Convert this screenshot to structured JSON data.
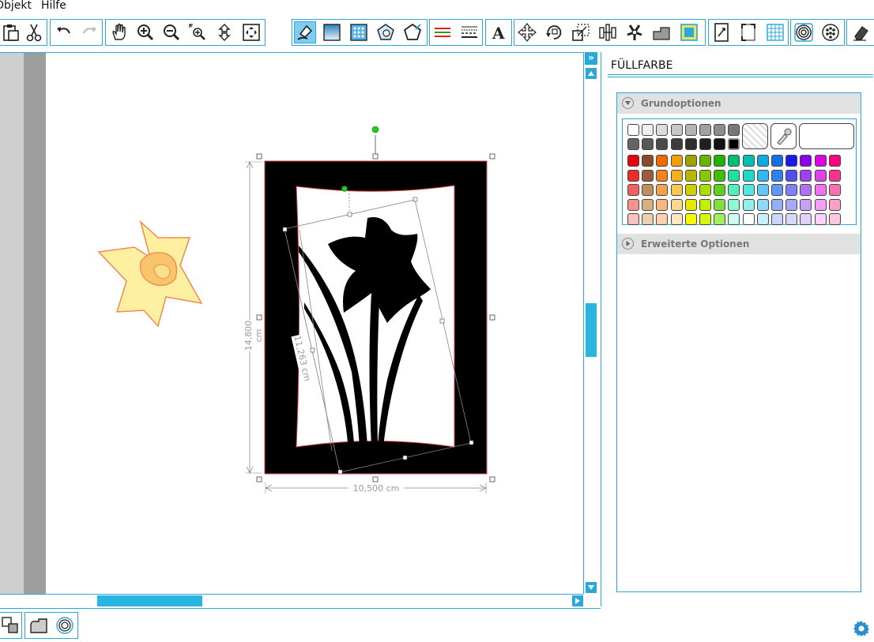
{
  "menu": {
    "objekt": "Objekt",
    "hilfe": "Hilfe"
  },
  "toolbar": {
    "groups": [
      {
        "buttons": [
          "paste-icon",
          "cut-icon"
        ]
      },
      {
        "buttons": [
          "undo-icon",
          "redo-icon"
        ]
      },
      {
        "buttons": [
          "pan-hand-icon",
          "zoom-in-icon",
          "zoom-out-icon",
          "zoom-select-icon",
          "zoom-fit-page-icon",
          "zoom-fit-all-icon"
        ]
      },
      {
        "buttons": [
          "fill-color-icon",
          "gradient-icon",
          "fill-pattern-icon",
          "advanced-fill-icon",
          "line-color-icon"
        ]
      },
      {
        "buttons": [
          "line-style-icon",
          "line-width-icon"
        ]
      },
      {
        "buttons": [
          "text-tool-icon"
        ]
      },
      {
        "buttons": [
          "move-tool-icon",
          "rotate-tool-icon",
          "scale-tool-icon",
          "align-tool-icon",
          "replicate-tool-icon",
          "modify-tool-icon",
          "mirror-tool-icon",
          "trace-icon"
        ]
      },
      {
        "buttons": [
          "page-setup-icon",
          "registration-marks-icon",
          "grid-icon"
        ]
      },
      {
        "buttons": [
          "offset-icon",
          "dots-icon"
        ]
      },
      {
        "buttons": [
          "eraser-icon"
        ]
      }
    ],
    "active": "fill-color-icon"
  },
  "canvas": {
    "dim_height": "14,800 cm",
    "dim_width": "10,500 cm",
    "dim_diagonal": "11,263 cm"
  },
  "panel": {
    "title": "FÜLLFARBE",
    "basic_options": "Grundoptionen",
    "advanced_options": "Erweiterte Optionen"
  },
  "palette": {
    "rows": [
      [
        "#ffffff",
        "#f0f0f0",
        "#dcdcdc",
        "#c8c8c8",
        "#b4b4b4",
        "#a0a0a0",
        "#8c8c8c",
        "#787878"
      ],
      [
        "#646464",
        "#585858",
        "#4a4a4a",
        "#3c3c3c",
        "#2e2e2e",
        "#202020",
        "#121212",
        "#000000"
      ],
      [
        "#e8000b",
        "#8b4b2a",
        "#f06a00",
        "#f0a000",
        "#a0a000",
        "#66b300",
        "#22b100",
        "#00c070",
        "#00c0b0",
        "#0fa8e0",
        "#1470e8",
        "#1a1ae8",
        "#8a00e8",
        "#e000e8",
        "#ff0080"
      ],
      [
        "#f02a2a",
        "#9a5c3a",
        "#f58020",
        "#f5b020",
        "#b8b800",
        "#88c800",
        "#40c000",
        "#20e0a0",
        "#20d8c8",
        "#30b8f0",
        "#3080f0",
        "#5050f0",
        "#a040f0",
        "#e040e8",
        "#ff3090"
      ],
      [
        "#f06060",
        "#c09060",
        "#f5a050",
        "#f8c850",
        "#d0d000",
        "#a8e000",
        "#60d020",
        "#50f0b8",
        "#50e8e0",
        "#60c8f8",
        "#6098f8",
        "#8080f8",
        "#b070f8",
        "#f070f0",
        "#ff70b0"
      ],
      [
        "#f89090",
        "#d8b080",
        "#f8b880",
        "#fad890",
        "#e8e800",
        "#c0f000",
        "#80e040",
        "#90f8d0",
        "#90f0f0",
        "#90d8f8",
        "#90b0f8",
        "#a8a8f8",
        "#c8a0f8",
        "#f8a0f8",
        "#ffa0c8"
      ],
      [
        "#fcc0c0",
        "#e8d0b0",
        "#fcd0b0",
        "#fce8c0",
        "#f8f800",
        "#d8f800",
        "#a0f060",
        "#d0fcf0",
        "#ffffff",
        "#c8f0fc",
        "#c8d8fc",
        "#d8d8fc",
        "#e0d0fc",
        "#fcd0fc",
        "#ffc8e0"
      ]
    ]
  }
}
